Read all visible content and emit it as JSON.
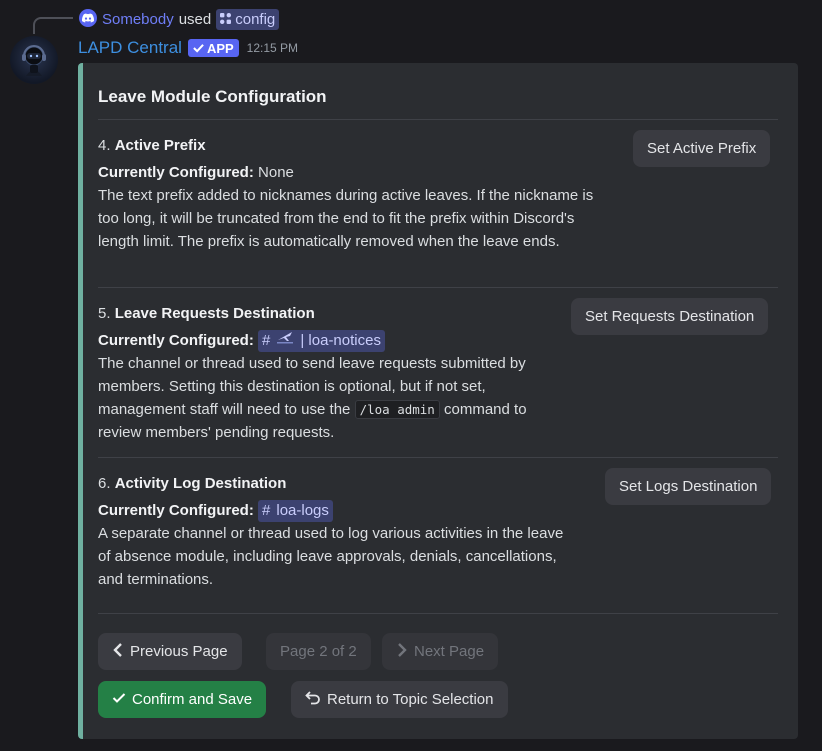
{
  "reply": {
    "user": "Somebody",
    "used": "used",
    "command": "config"
  },
  "header": {
    "bot_name": "LAPD Central",
    "app_badge": "APP",
    "timestamp": "12:15 PM"
  },
  "embed": {
    "title": "Leave Module Configuration",
    "accent_color": "#6fb0a0",
    "fields": [
      {
        "number": "4.",
        "heading": "Active Prefix",
        "configured_label": "Currently Configured:",
        "configured_value": "None",
        "description": "The text prefix added to nicknames during active leaves. If the nickname is too long, it will be truncated from the end to fit the prefix within Discord's length limit. The prefix is automatically removed when the leave ends.",
        "button": "Set Active Prefix"
      },
      {
        "number": "5.",
        "heading": "Leave Requests Destination",
        "configured_label": "Currently Configured:",
        "configured_channel": "| loa-notices",
        "description_pre": "The channel or thread used to send leave requests submitted by members. Setting this destination is optional, but if not set, management staff will need to use the",
        "description_code": "/loa admin",
        "description_post": "command to review members' pending requests.",
        "button": "Set Requests Destination"
      },
      {
        "number": "6.",
        "heading": "Activity Log Destination",
        "configured_label": "Currently Configured:",
        "configured_channel": "loa-logs",
        "description": "A separate channel or thread used to log various activities in the leave of absence module, including leave approvals, denials, cancellations, and terminations.",
        "button": "Set Logs Destination"
      }
    ]
  },
  "buttons": {
    "previous": "Previous Page",
    "page_indicator": "Page 2 of 2",
    "next": "Next Page",
    "confirm": "Confirm and Save",
    "return": "Return to Topic Selection"
  },
  "icons": [
    "discord-icon",
    "slash-command-icon",
    "checkmark-icon",
    "chevron-left-icon",
    "chevron-right-icon",
    "return-arrow-icon",
    "hash-icon",
    "airplane-icon"
  ]
}
